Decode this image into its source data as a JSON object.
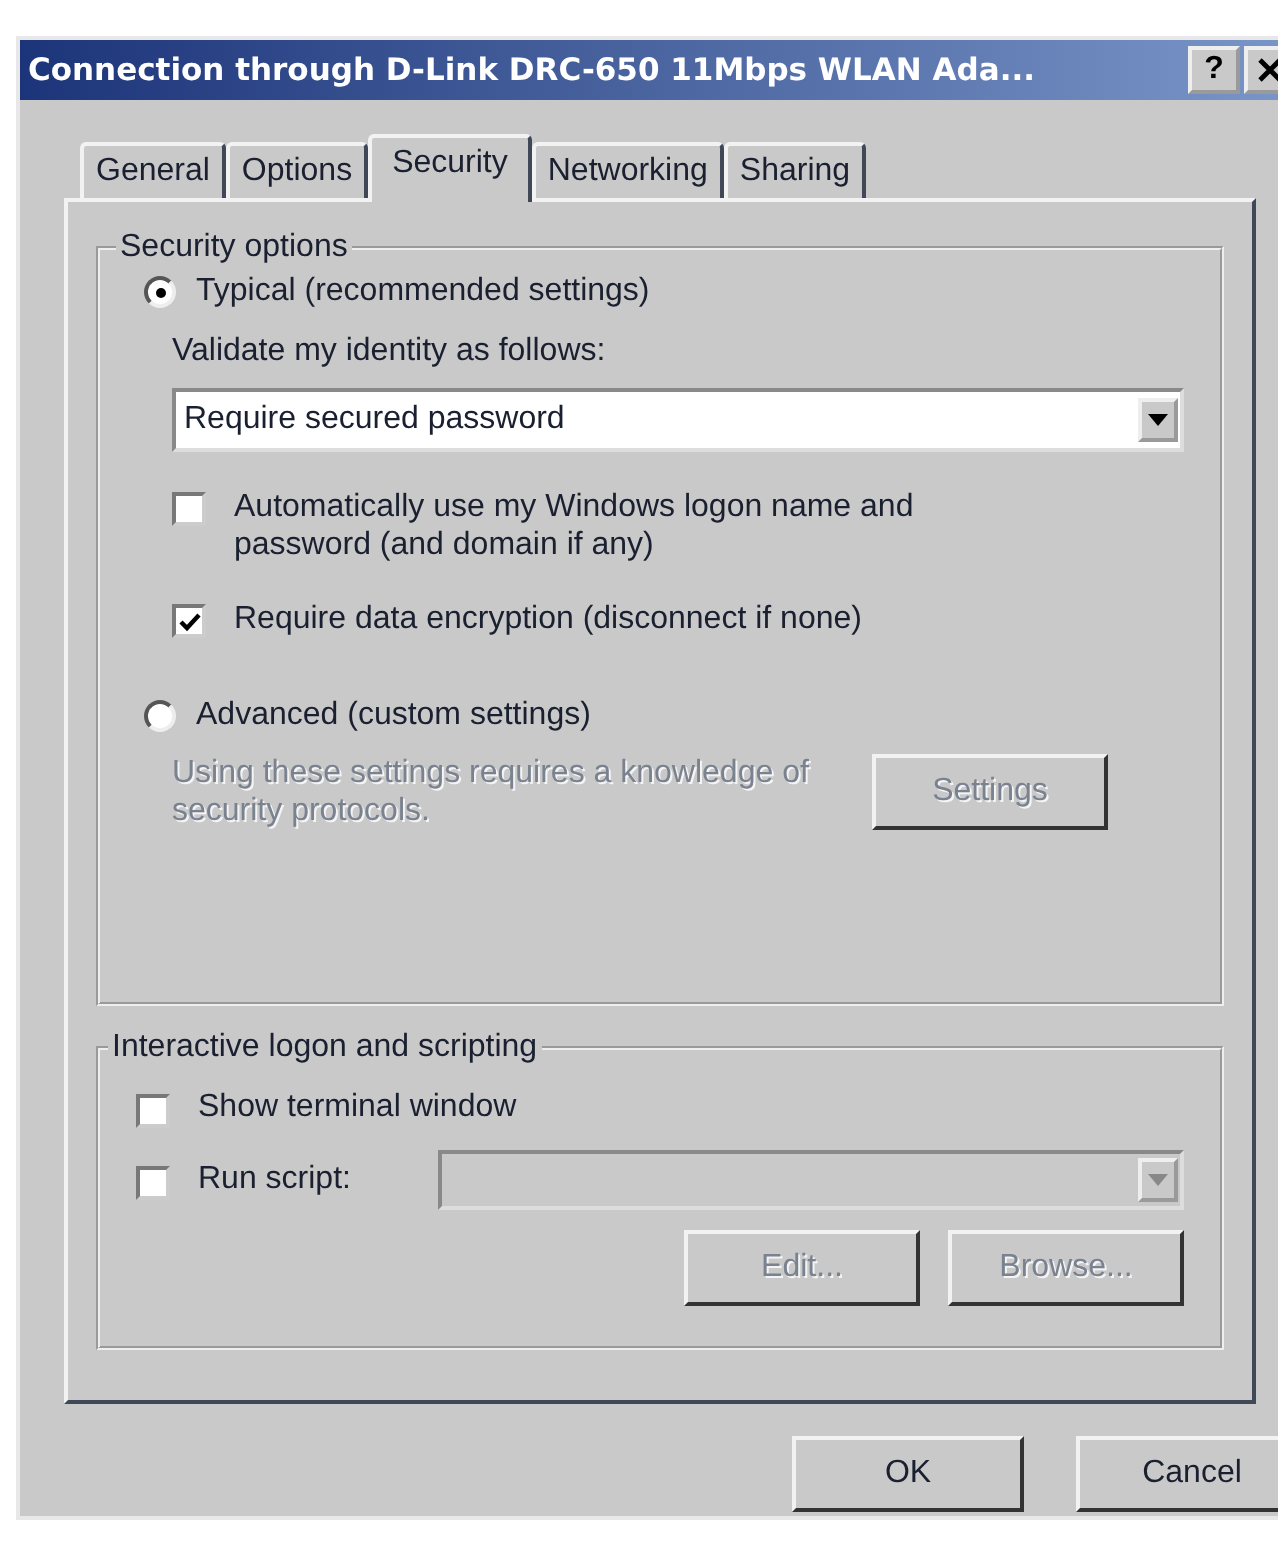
{
  "window": {
    "title": "Connection through D-Link DRC-650 11Mbps WLAN Ada...",
    "help_button": "?"
  },
  "tabs": [
    {
      "label": "General",
      "selected": false
    },
    {
      "label": "Options",
      "selected": false
    },
    {
      "label": "Security",
      "selected": true
    },
    {
      "label": "Networking",
      "selected": false
    },
    {
      "label": "Sharing",
      "selected": false
    }
  ],
  "security_options": {
    "legend": "Security options",
    "typical": {
      "label": "Typical (recommended settings)",
      "selected": true
    },
    "validate_label": "Validate my identity as follows:",
    "validate_dropdown": {
      "value": "Require secured password"
    },
    "checkboxes": [
      {
        "label": "Automatically use my Windows logon name and password (and domain if any)",
        "checked": false
      },
      {
        "label": "Require data encryption (disconnect if none)",
        "checked": true
      }
    ],
    "advanced": {
      "label": "Advanced (custom settings)",
      "selected": false
    },
    "advanced_note": "Using these settings requires a knowledge of security protocols.",
    "settings_button": {
      "label": "Settings",
      "disabled": true
    }
  },
  "interactive": {
    "legend": "Interactive logon and scripting",
    "checkboxes": [
      {
        "label": "Show terminal window",
        "checked": false
      },
      {
        "label": "Run script:",
        "checked": false
      }
    ],
    "script_dropdown": {
      "disabled": true
    },
    "buttons": [
      {
        "label": "Edit...",
        "disabled": true
      },
      {
        "label": "Browse...",
        "disabled": true
      }
    ]
  },
  "buttons": [
    {
      "label": "OK"
    },
    {
      "label": "Cancel"
    }
  ]
}
